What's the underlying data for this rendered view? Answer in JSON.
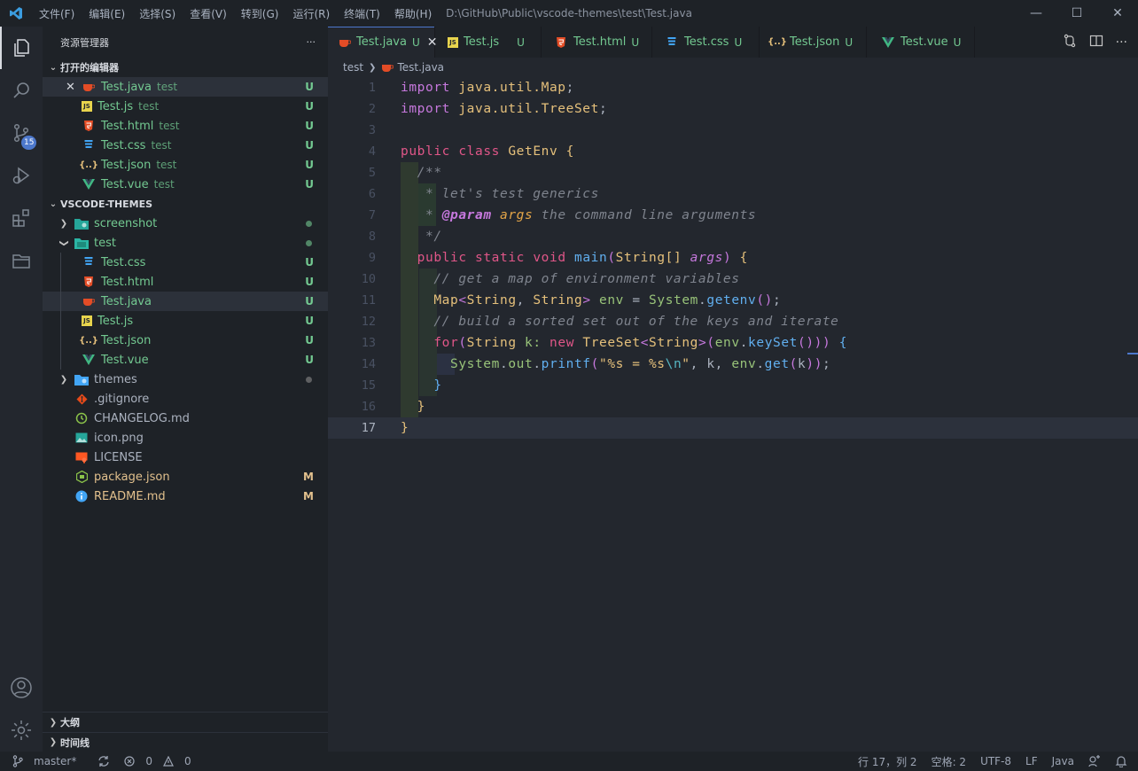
{
  "titlebar": {
    "menu": [
      "文件(F)",
      "编辑(E)",
      "选择(S)",
      "查看(V)",
      "转到(G)",
      "运行(R)",
      "终端(T)",
      "帮助(H)"
    ],
    "window_title": "D:\\GitHub\\Public\\vscode-themes\\test\\Test.java"
  },
  "activity": {
    "scm_badge": "15",
    "items": [
      "explorer-icon",
      "search-icon",
      "source-control-icon",
      "run-debug-icon",
      "extensions-icon",
      "remote-explorer-icon",
      "account-icon",
      "settings-gear-icon"
    ]
  },
  "sidebar": {
    "title": "资源管理器",
    "more": "···",
    "open_editors": {
      "label": "打开的编辑器",
      "items": [
        {
          "name": "Test.java",
          "desc": "test",
          "status": "U",
          "icon": "java-icon"
        },
        {
          "name": "Test.js",
          "desc": "test",
          "status": "U",
          "icon": "js-icon"
        },
        {
          "name": "Test.html",
          "desc": "test",
          "status": "U",
          "icon": "html-icon"
        },
        {
          "name": "Test.css",
          "desc": "test",
          "status": "U",
          "icon": "css-icon"
        },
        {
          "name": "Test.json",
          "desc": "test",
          "status": "U",
          "icon": "json-icon"
        },
        {
          "name": "Test.vue",
          "desc": "test",
          "status": "U",
          "icon": "vue-icon"
        }
      ]
    },
    "workspace": {
      "label": "VSCODE-THEMES",
      "folders": {
        "screenshot": "screenshot",
        "test": "test",
        "themes": "themes"
      },
      "test_files": [
        {
          "name": "Test.css",
          "status": "U"
        },
        {
          "name": "Test.html",
          "status": "U"
        },
        {
          "name": "Test.java",
          "status": "U"
        },
        {
          "name": "Test.js",
          "status": "U"
        },
        {
          "name": "Test.json",
          "status": "U"
        },
        {
          "name": "Test.vue",
          "status": "U"
        }
      ],
      "root_files": [
        {
          "name": ".gitignore",
          "status": ""
        },
        {
          "name": "CHANGELOG.md",
          "status": ""
        },
        {
          "name": "icon.png",
          "status": ""
        },
        {
          "name": "LICENSE",
          "status": ""
        },
        {
          "name": "package.json",
          "status": "M"
        },
        {
          "name": "README.md",
          "status": "M"
        }
      ]
    },
    "outline": "大纲",
    "timeline": "时间线"
  },
  "tabs": [
    {
      "name": "Test.java",
      "status": "U"
    },
    {
      "name": "Test.js",
      "status": "U"
    },
    {
      "name": "Test.html",
      "status": "U"
    },
    {
      "name": "Test.css",
      "status": "U"
    },
    {
      "name": "Test.json",
      "status": "U"
    },
    {
      "name": "Test.vue",
      "status": "U"
    }
  ],
  "breadcrumb": {
    "folder": "test",
    "file": "Test.java"
  },
  "code": {
    "line_numbers": [
      "1",
      "2",
      "3",
      "4",
      "5",
      "6",
      "7",
      "8",
      "9",
      "10",
      "11",
      "12",
      "13",
      "14",
      "15",
      "16",
      "17"
    ],
    "l1": {
      "kw": "import",
      "pkg": "java.util.Map",
      "end": ";"
    },
    "l2": {
      "kw": "import",
      "pkg": "java.util.TreeSet",
      "end": ";"
    },
    "l4": {
      "mod": "public",
      "kw": "class",
      "name": "GetEnv",
      "brace": "{"
    },
    "l5": "/**",
    "l6": "* let's test generics",
    "l7": {
      "star": "*",
      "tag": "@param",
      "arg": "args",
      "rest": "the command line arguments"
    },
    "l8": "*/",
    "l9": {
      "m1": "public",
      "m2": "static",
      "m3": "void",
      "fn": "main",
      "type": "String[]",
      "arg": "args",
      "brace": "{"
    },
    "l10": "// get a map of environment variables",
    "l11": {
      "t1": "Map",
      "t2": "String",
      "t3": "String",
      "var": "env",
      "cls": "System",
      "fn": "getenv"
    },
    "l12": "// build a sorted set out of the keys and iterate",
    "l13": {
      "kw": "for",
      "type": "String",
      "var": "k",
      "new": "new",
      "cls": "TreeSet",
      "gen": "String",
      "env": "env",
      "fn": "keySet"
    },
    "l14": {
      "cls": "System",
      "out": "out",
      "fn": "printf",
      "str1": "\"%s = %s",
      "esc": "\\n",
      "str2": "\"",
      "k": "k",
      "env": "env",
      "get": "get"
    },
    "l15": "}",
    "l16": "}",
    "l17": "}"
  },
  "status": {
    "branch": "master*",
    "errors": "0",
    "warnings": "0",
    "position": "行 17，列 2",
    "spaces": "空格: 2",
    "encoding": "UTF-8",
    "eol": "LF",
    "language": "Java"
  }
}
